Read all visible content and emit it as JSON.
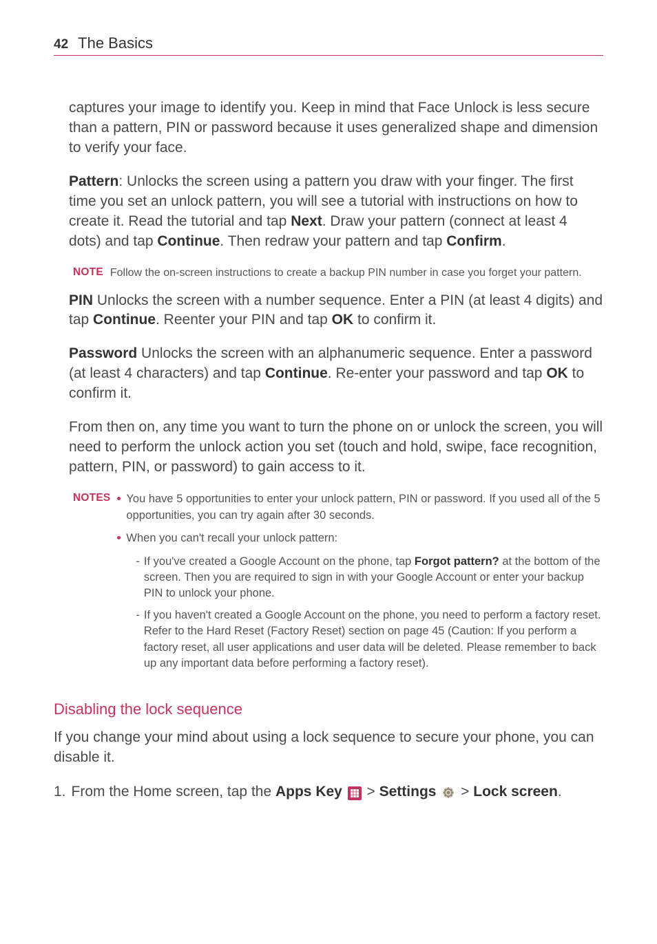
{
  "header": {
    "page_number": "42",
    "section": "The Basics"
  },
  "paragraphs": {
    "intro": "captures your image to identify you. Keep in mind that Face Unlock is less secure than a pattern, PIN or password because it uses generalized shape and dimension to verify your face.",
    "pattern_label": "Pattern",
    "pattern_1": ": Unlocks the screen using a pattern you draw with your finger. The first time you set an unlock pattern, you will see a tutorial with instructions on how to create it. Read the tutorial and tap ",
    "next": "Next",
    "pattern_2": ". Draw your pattern (connect at least 4 dots) and tap ",
    "continue": "Continue",
    "pattern_3": ". Then redraw your pattern and tap ",
    "confirm": "Confirm",
    "pattern_4": ".",
    "pin_label": "PIN",
    "pin_1": " Unlocks the screen with a number sequence. Enter a PIN (at least 4 digits) and tap ",
    "pin_2": ". Reenter your PIN and tap ",
    "ok": "OK",
    "pin_3": " to confirm it.",
    "password_label": "Password",
    "password_1": " Unlocks the screen with an alphanumeric sequence. Enter a password (at least 4 characters) and tap ",
    "password_2": ". Re-enter your password and tap ",
    "password_3": " to confirm it.",
    "from_then": "From then on, any time you want to turn the phone on or unlock the screen, you will need to perform the unlock action you set (touch and hold, swipe, face recognition, pattern, PIN, or password) to gain access to it."
  },
  "note1": {
    "label": "NOTE",
    "text": "Follow the on-screen instructions to create a backup PIN number in case you forget your pattern."
  },
  "notes2": {
    "label": "NOTES",
    "bullet1": "You have 5 opportunities to enter your unlock pattern, PIN or password. If you used all of the 5 opportunities, you can try again after 30 seconds.",
    "bullet2": "When you can't recall your unlock pattern:",
    "sub1_a": "If you've created a Google Account on the phone, tap ",
    "sub1_bold": "Forgot pattern?",
    "sub1_b": " at the bottom of the screen. Then you are required to sign in with your Google Account or enter your backup PIN to unlock your phone.",
    "sub2": "If you haven't created a Google Account on the phone, you need to perform a factory reset. Refer to the Hard Reset (Factory Reset) section on page 45 (Caution: If you perform a factory reset, all user applications and user data will be deleted. Please remember to back up any important data before performing a factory reset)."
  },
  "disable": {
    "title": "Disabling the lock sequence",
    "intro": "If you change your mind about using a lock sequence to secure your phone, you can disable it.",
    "step_num": "1.",
    "step_a": "From the Home screen, tap the ",
    "apps_key": "Apps Key",
    "gt": " > ",
    "settings": "Settings",
    "lock_screen": "Lock screen",
    "step_end": "."
  }
}
